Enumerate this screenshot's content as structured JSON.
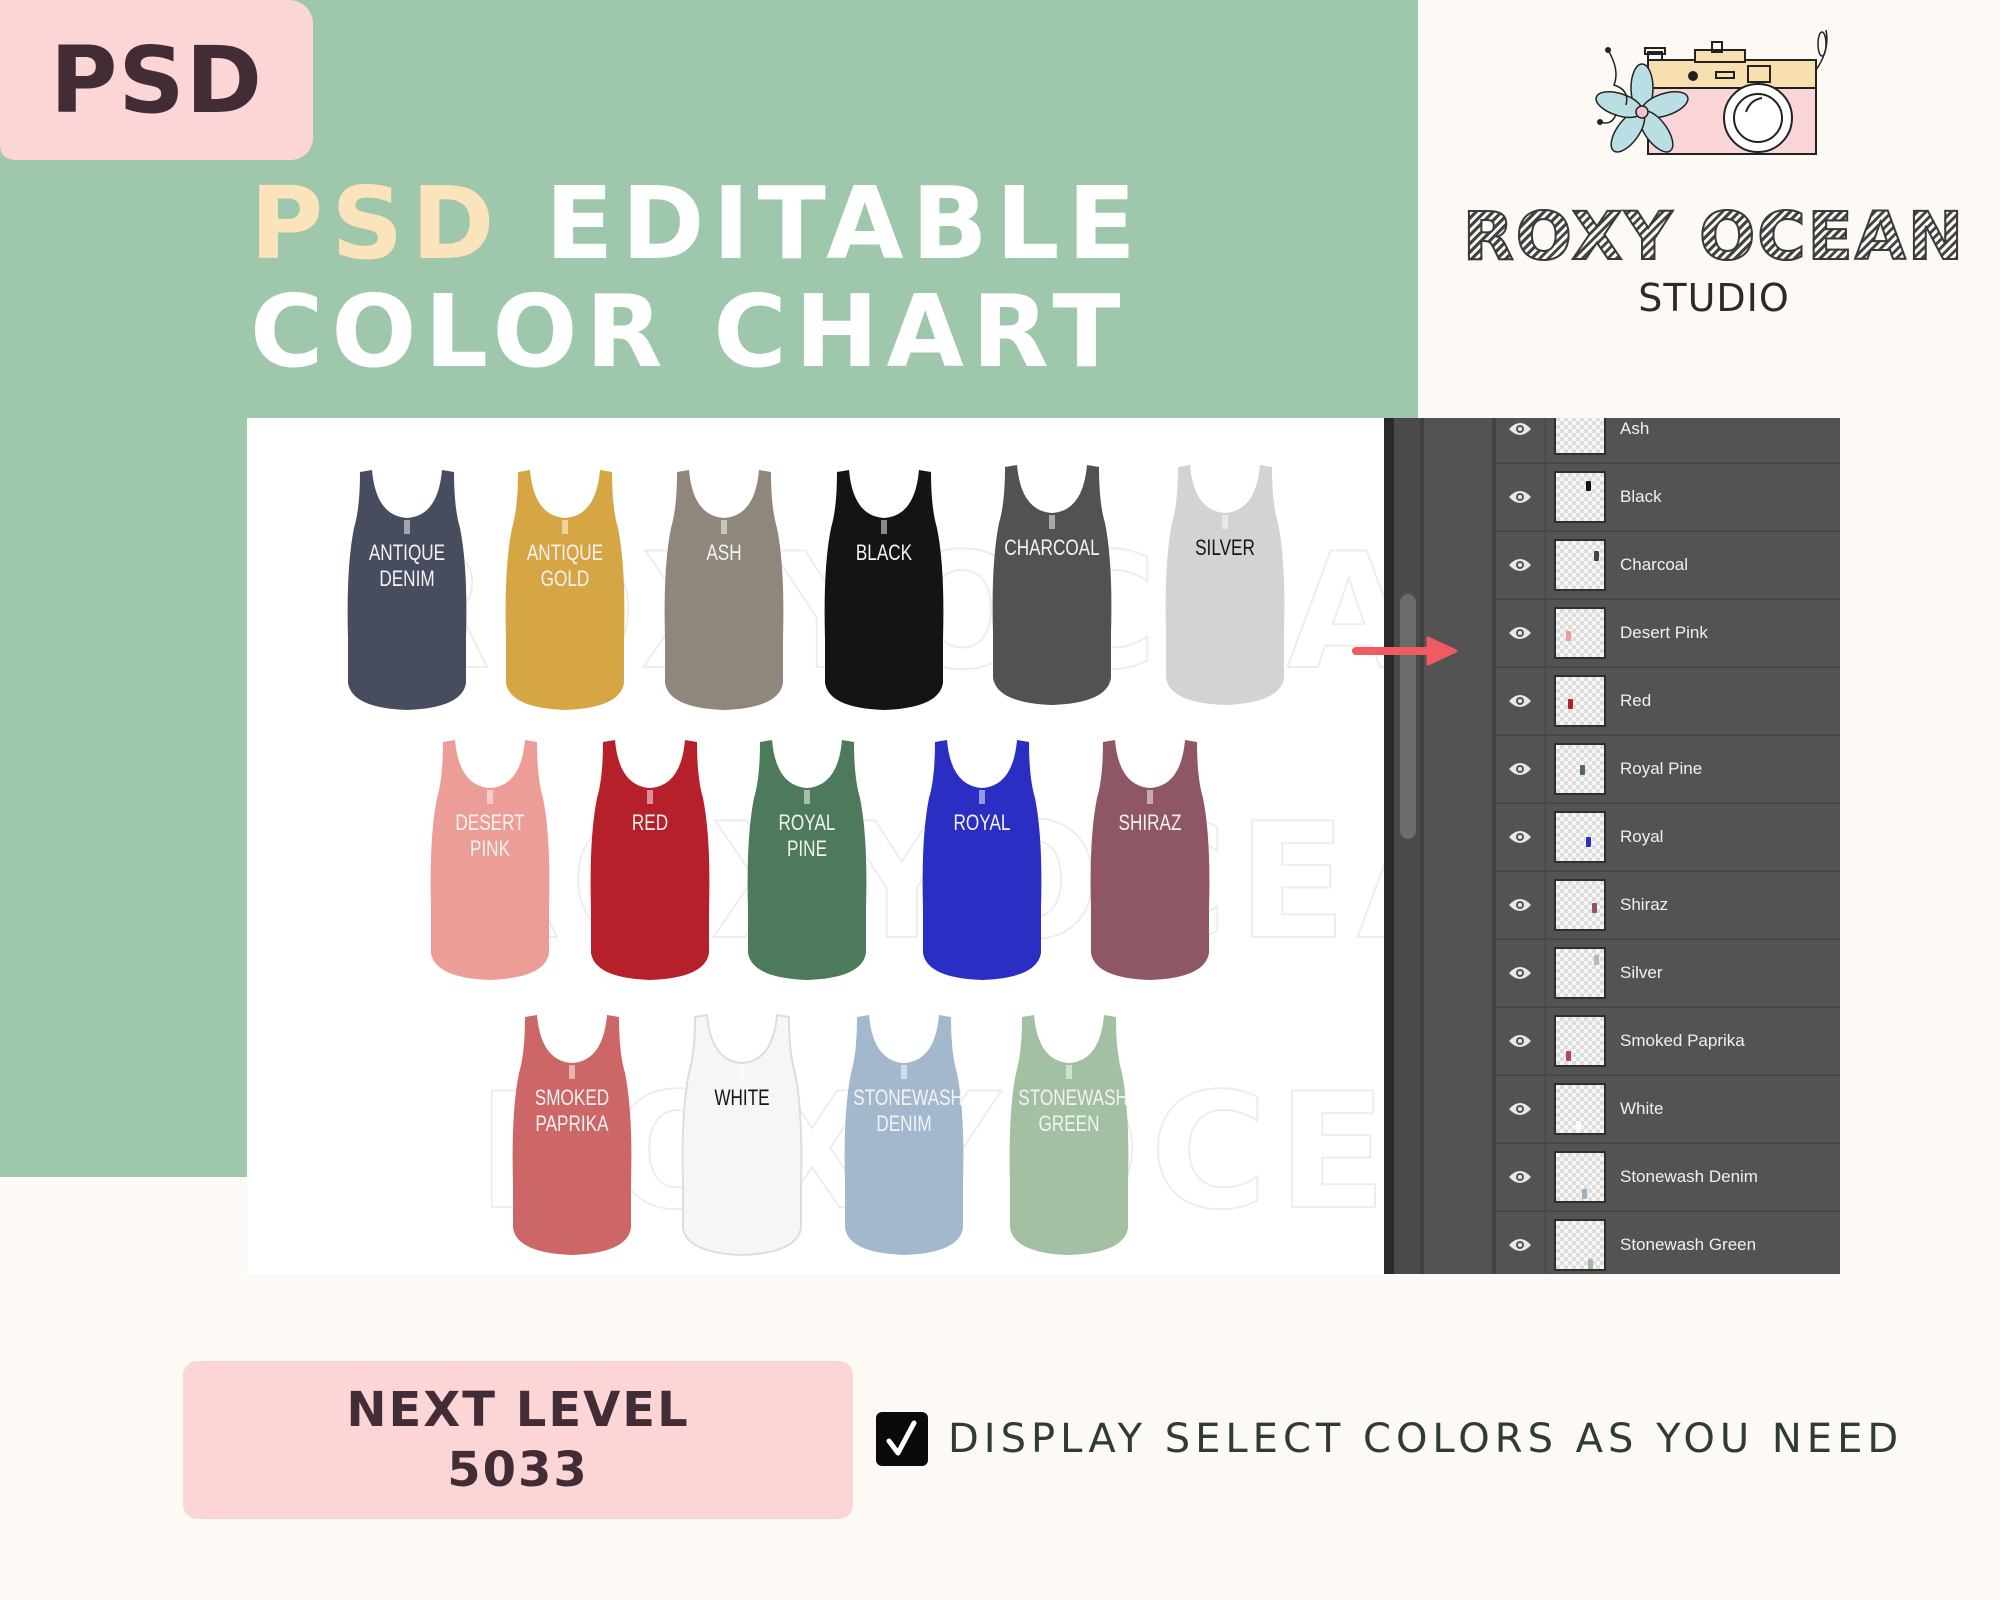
{
  "badge": {
    "label": "PSD"
  },
  "headline": {
    "accent": "PSD",
    "line1_rest": "EDITABLE",
    "line2": "COLOR CHART"
  },
  "logo": {
    "icon": "camera-with-flower-icon",
    "brand": "ROXY OCEAN",
    "subtitle": "STUDIO"
  },
  "mockup": {
    "watermark": "ROXYOCEAN",
    "tanks": [
      {
        "label_lines": [
          "ANTIQUE",
          "DENIM"
        ],
        "color": "#474c5e",
        "label_dark": false
      },
      {
        "label_lines": [
          "ANTIQUE",
          "GOLD"
        ],
        "color": "#d7a644",
        "label_dark": false
      },
      {
        "label_lines": [
          "ASH"
        ],
        "color": "#8f877c",
        "label_dark": false
      },
      {
        "label_lines": [
          "BLACK"
        ],
        "color": "#141414",
        "label_dark": false
      },
      {
        "label_lines": [
          "CHARCOAL"
        ],
        "color": "#525252",
        "label_dark": false
      },
      {
        "label_lines": [
          "SILVER"
        ],
        "color": "#d3d3d3",
        "label_dark": true
      },
      {
        "label_lines": [
          "DESERT",
          "PINK"
        ],
        "color": "#ec9d97",
        "label_dark": false
      },
      {
        "label_lines": [
          "RED"
        ],
        "color": "#b5202a",
        "label_dark": false
      },
      {
        "label_lines": [
          "ROYAL",
          "PINE"
        ],
        "color": "#4e7a5c",
        "label_dark": false
      },
      {
        "label_lines": [
          "ROYAL"
        ],
        "color": "#2a2ec3",
        "label_dark": false
      },
      {
        "label_lines": [
          "SHIRAZ"
        ],
        "color": "#8f5663",
        "label_dark": false
      },
      {
        "label_lines": [
          "SMOKED",
          "PAPRIKA"
        ],
        "color": "#cd6666",
        "label_dark": false
      },
      {
        "label_lines": [
          "WHITE"
        ],
        "color": "#f6f6f6",
        "label_dark": true
      },
      {
        "label_lines": [
          "STONEWASH",
          "DENIM"
        ],
        "color": "#a4b8cd",
        "label_dark": false
      },
      {
        "label_lines": [
          "STONEWASH",
          "GREEN"
        ],
        "color": "#a3c0a3",
        "label_dark": false
      }
    ]
  },
  "layers_panel": {
    "layers": [
      {
        "name": "Ash",
        "visible": true,
        "swatch": "#8f877c"
      },
      {
        "name": "Black",
        "visible": true,
        "swatch": "#141414"
      },
      {
        "name": "Charcoal",
        "visible": true,
        "swatch": "#444444"
      },
      {
        "name": "Desert Pink",
        "visible": true,
        "swatch": "#ec9d97"
      },
      {
        "name": "Red",
        "visible": true,
        "swatch": "#b5202a"
      },
      {
        "name": "Royal Pine",
        "visible": true,
        "swatch": "#4e6a5c"
      },
      {
        "name": "Royal",
        "visible": true,
        "swatch": "#2a2ec3"
      },
      {
        "name": "Shiraz",
        "visible": true,
        "swatch": "#8f5663"
      },
      {
        "name": "Silver",
        "visible": true,
        "swatch": "#b8b8b8"
      },
      {
        "name": "Smoked Paprika",
        "visible": true,
        "swatch": "#b84a55"
      },
      {
        "name": "White",
        "visible": true,
        "swatch": "#ffffff"
      },
      {
        "name": "Stonewash Denim",
        "visible": true,
        "swatch": "#9fb0c2"
      },
      {
        "name": "Stonewash Green",
        "visible": true,
        "swatch": "#a3b8a3"
      }
    ]
  },
  "model": {
    "line1": "NEXT LEVEL",
    "line2": "5033"
  },
  "feature": {
    "checked": true,
    "text": "DISPLAY SELECT COLORS AS YOU NEED"
  },
  "colors": {
    "green": "#9fc7ab",
    "pink": "#fcd6d7",
    "cream": "#fdf9f4",
    "dark_plum": "#422d37",
    "accent_yellow": "#fbe4bb",
    "arrow_red": "#f05a61",
    "panel_gray": "#535353"
  }
}
